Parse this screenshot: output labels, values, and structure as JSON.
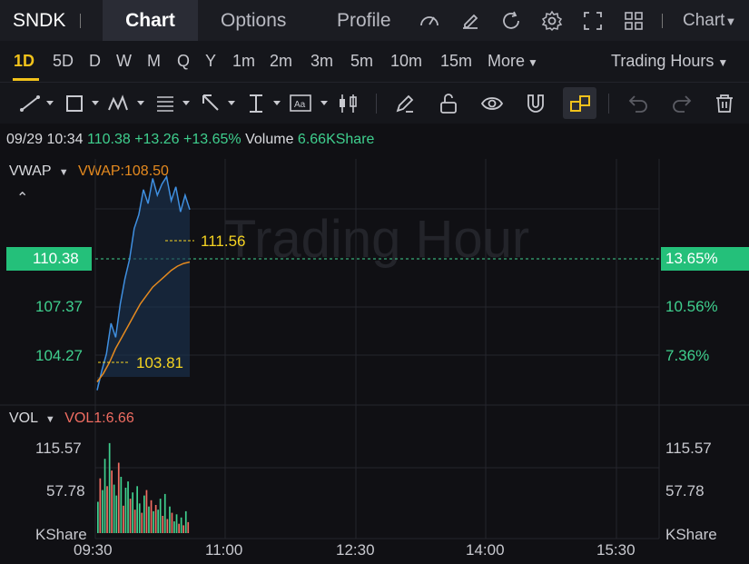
{
  "header": {
    "symbol": "SNDK",
    "tabs": [
      {
        "label": "Chart"
      },
      {
        "label": "Options"
      },
      {
        "label": "Profile"
      }
    ],
    "chart_menu": "Chart"
  },
  "periods": [
    "1D",
    "5D",
    "D",
    "W",
    "M",
    "Q",
    "Y",
    "1m",
    "2m",
    "3m",
    "5m",
    "10m",
    "15m"
  ],
  "active_period": "1D",
  "more_label": "More",
  "trading_hours_label": "Trading Hours",
  "quote": {
    "time": "09/29 10:34",
    "price": "110.38",
    "change": "+13.26",
    "change_pct": "+13.65%",
    "volume_label": "Volume",
    "volume": "6.66KShare"
  },
  "indicator": {
    "name": "VWAP",
    "value_label": "VWAP:108.50"
  },
  "watermark": "Trading Hour",
  "price_axis": {
    "left_current": "110.38",
    "right_current": "13.65%",
    "left_ticks": [
      "107.37",
      "104.27"
    ],
    "right_ticks": [
      "10.56%",
      "7.36%"
    ],
    "high_label": "111.56",
    "low_label": "103.81"
  },
  "volume_panel": {
    "name": "VOL",
    "value_label": "VOL1:6.66",
    "ticks": [
      "115.57",
      "57.78"
    ],
    "unit": "KShare"
  },
  "time_axis": [
    "09:30",
    "11:00",
    "12:30",
    "14:00",
    "15:30"
  ],
  "colors": {
    "accent": "#f1c21b",
    "up": "#3fcf8e",
    "down": "#f06d62",
    "price_line": "#3f8fe0",
    "vwap_line": "#e58a1f"
  },
  "chart_data": {
    "type": "line",
    "series": [
      {
        "name": "VWAP",
        "values": [
          104.2,
          104.5,
          104.9,
          105.4,
          105.8,
          106.2,
          106.6,
          107.0,
          107.3,
          107.6,
          107.8,
          108.0,
          108.2,
          108.35,
          108.45,
          108.5
        ]
      }
    ],
    "price": [
      103.9,
      104.6,
      105.2,
      106.3,
      105.8,
      107.0,
      107.9,
      108.6,
      109.7,
      110.2,
      111.1,
      110.6,
      111.5,
      110.9,
      111.3,
      111.56,
      110.7,
      111.2,
      110.3,
      110.9,
      110.38
    ],
    "ylim": [
      103.4,
      112.2
    ],
    "x": [
      "09:30",
      "11:00",
      "12:30",
      "14:00",
      "15:30"
    ],
    "volume": [
      40,
      70,
      55,
      95,
      60,
      115,
      80,
      62,
      48,
      90,
      72,
      35,
      58,
      66,
      44,
      52,
      30,
      60,
      38,
      26,
      48,
      55,
      34,
      42,
      28,
      36,
      30,
      44,
      22,
      50,
      18,
      34,
      26,
      15,
      24,
      12,
      20,
      10,
      28,
      14
    ],
    "volume_up": [
      1,
      0,
      1,
      1,
      0,
      1,
      0,
      1,
      1,
      0,
      1,
      0,
      1,
      1,
      0,
      1,
      0,
      1,
      1,
      0,
      1,
      0,
      1,
      0,
      1,
      0,
      1,
      1,
      0,
      1,
      0,
      1,
      0,
      1,
      1,
      0,
      1,
      0,
      1,
      0
    ],
    "volume_ylim": [
      0,
      130
    ]
  }
}
